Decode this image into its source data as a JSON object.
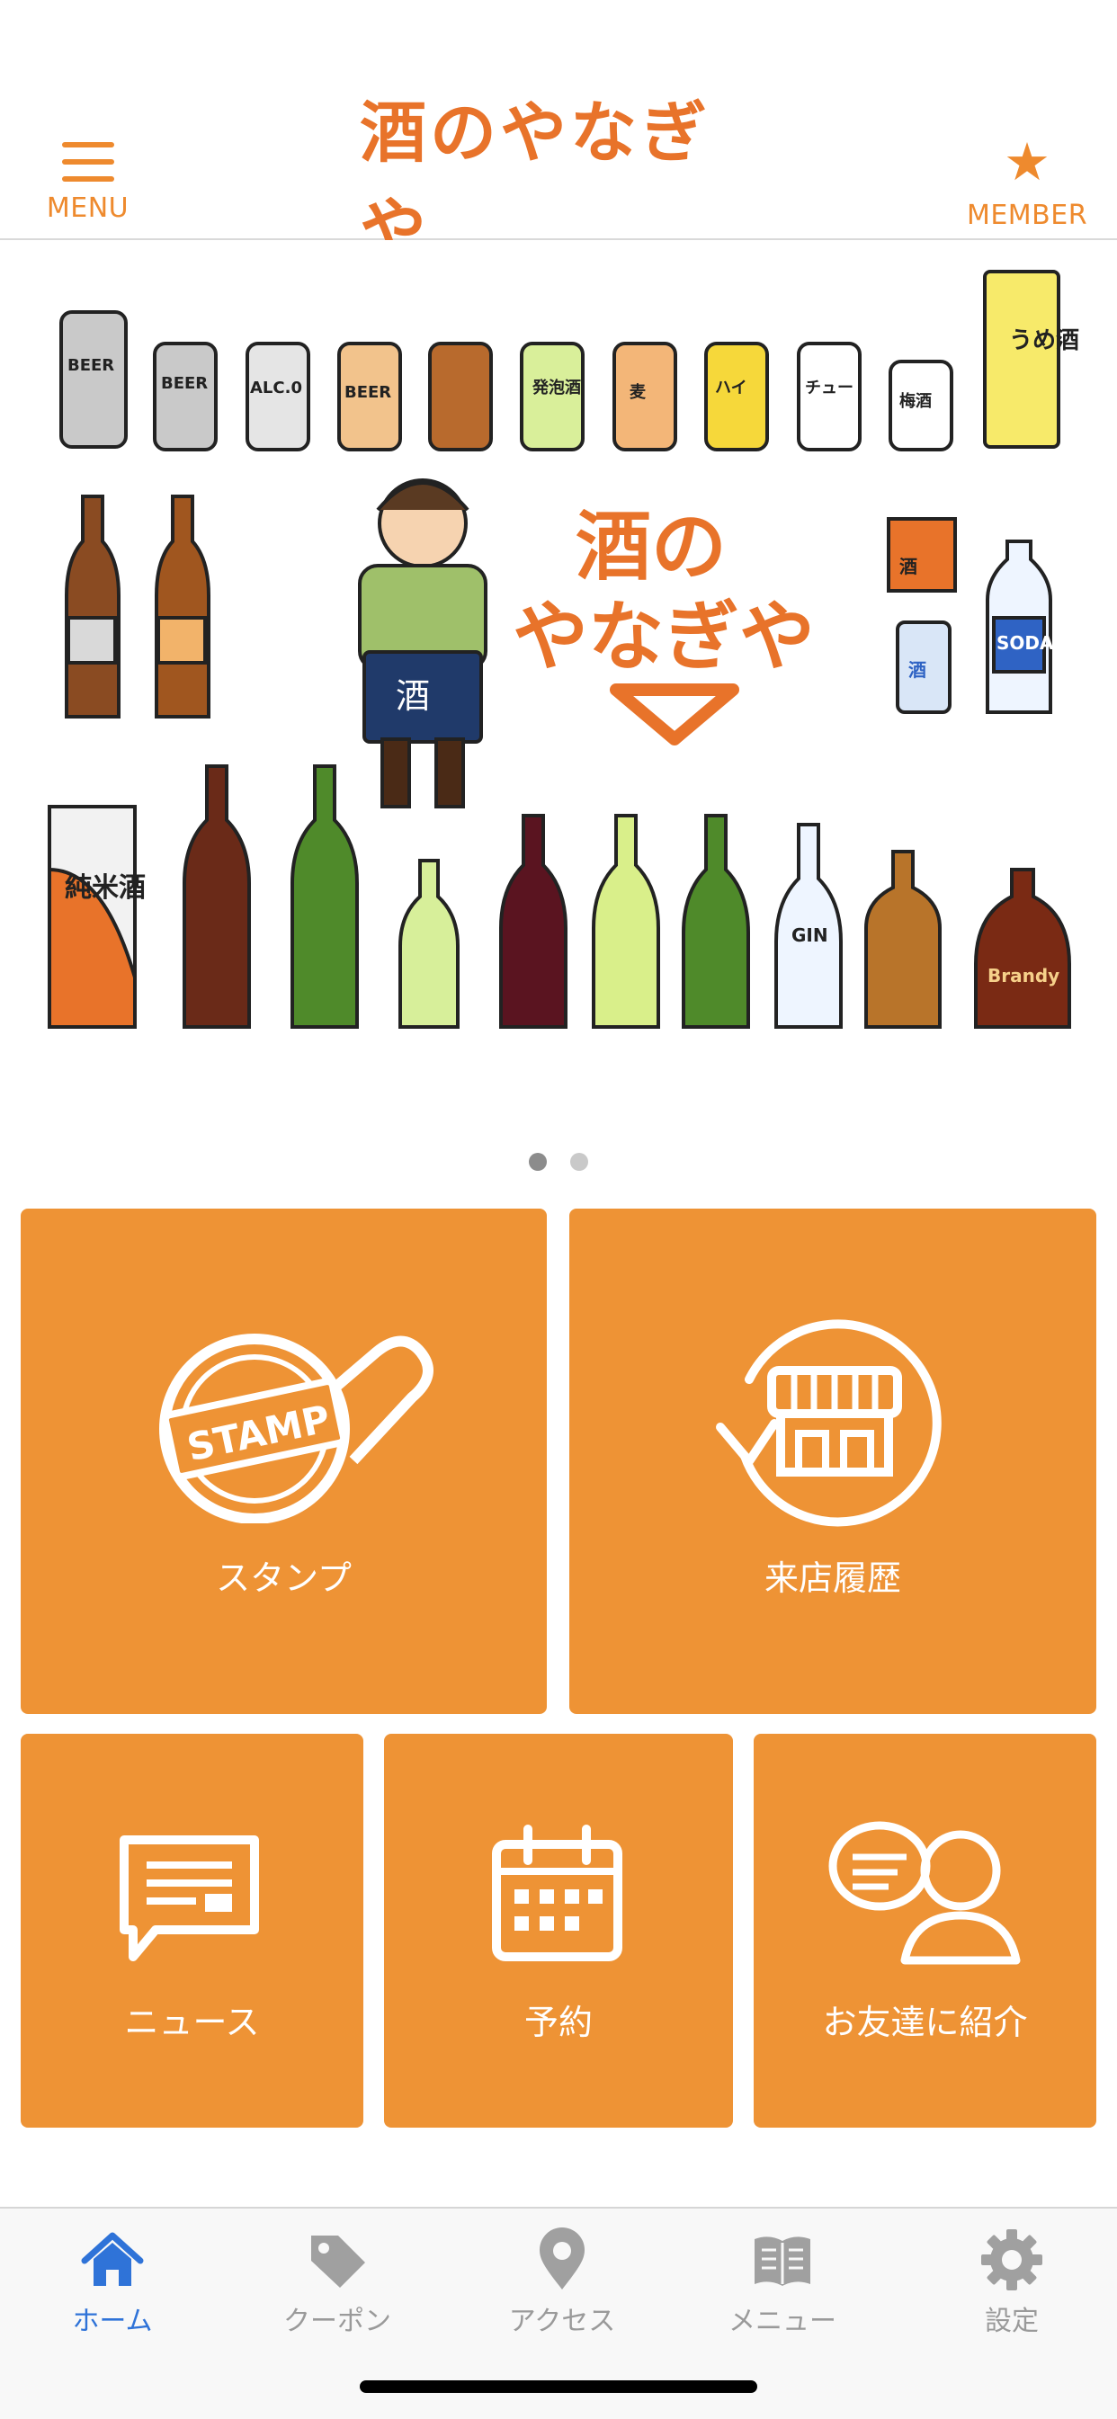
{
  "header": {
    "menu_label": "MENU",
    "logo_text": "酒のやなぎや",
    "member_label": "MEMBER",
    "accent_color": "#ee8a2e"
  },
  "banner": {
    "logo_line1": "酒の",
    "logo_line2": "やなぎや",
    "page_indicator": {
      "total": 2,
      "active": 1
    }
  },
  "tiles": [
    {
      "label": "スタンプ",
      "icon": "stamp-icon",
      "icon_text": "STAMP"
    },
    {
      "label": "来店履歴",
      "icon": "store-history-icon"
    },
    {
      "label": "ニュース",
      "icon": "news-icon"
    },
    {
      "label": "予約",
      "icon": "calendar-icon"
    },
    {
      "label": "お友達に紹介",
      "icon": "friend-referral-icon"
    }
  ],
  "tabbar": {
    "items": [
      {
        "label": "ホーム",
        "icon": "home-icon",
        "active": true
      },
      {
        "label": "クーポン",
        "icon": "coupon-icon",
        "active": false
      },
      {
        "label": "アクセス",
        "icon": "map-pin-icon",
        "active": false
      },
      {
        "label": "メニュー",
        "icon": "book-icon",
        "active": false
      },
      {
        "label": "設定",
        "icon": "gear-icon",
        "active": false
      }
    ],
    "active_color": "#2f73d8",
    "inactive_color": "#9a9a9a"
  }
}
